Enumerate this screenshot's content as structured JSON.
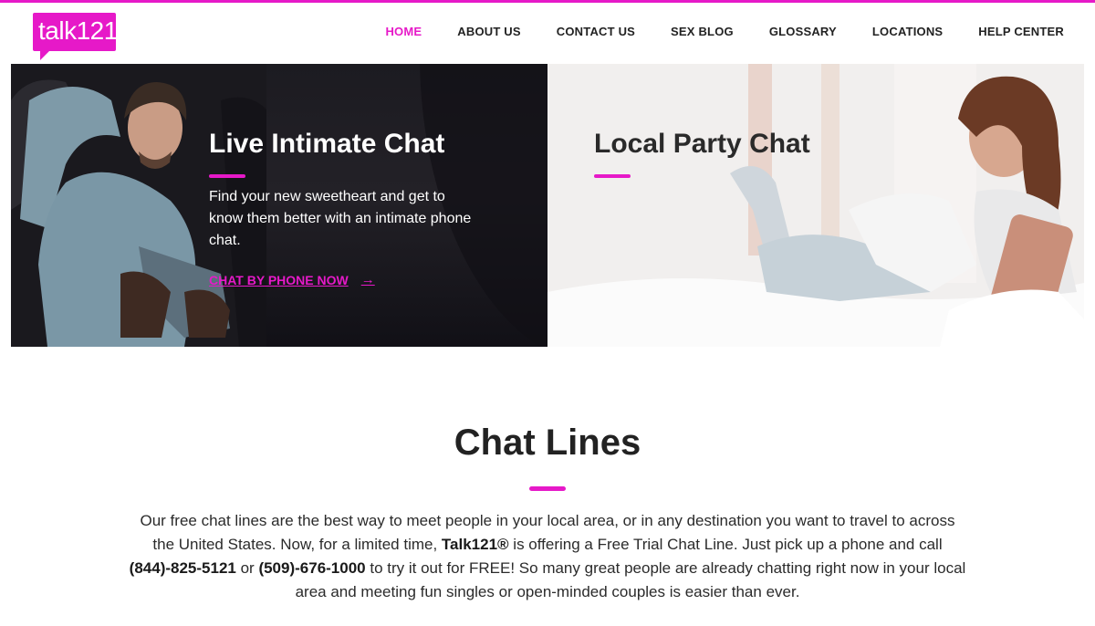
{
  "brand": {
    "logo_text": "talk121",
    "accent_color": "#e619c8"
  },
  "nav": {
    "items": [
      {
        "label": "HOME",
        "active": true
      },
      {
        "label": "ABOUT US",
        "active": false
      },
      {
        "label": "CONTACT US",
        "active": false
      },
      {
        "label": "SEX BLOG",
        "active": false
      },
      {
        "label": "GLOSSARY",
        "active": false
      },
      {
        "label": "LOCATIONS",
        "active": false
      },
      {
        "label": "HELP CENTER",
        "active": false
      }
    ]
  },
  "hero": {
    "left": {
      "title": "Live Intimate Chat",
      "description": "Find your new sweetheart and get to know them better with an intimate phone chat.",
      "cta_label": "CHAT BY PHONE NOW",
      "cta_icon": "arrow-right-icon"
    },
    "right": {
      "title": "Local Party Chat"
    }
  },
  "chat_lines": {
    "title": "Chat Lines",
    "body_part1": "Our free chat lines are the best way to meet people in your local area, or in any destination you want to travel to across the United States. Now, for a limited time, ",
    "brand_name": "Talk121®",
    "body_part2": " is offering a Free Trial Chat Line. Just pick up a phone and call ",
    "phone_1": "(844)-825-5121",
    "body_part3": " or ",
    "phone_2": "(509)-676-1000",
    "body_part4": " to try it out for FREE! So many great people are already chatting right now in your local area and meeting fun singles or open-minded couples is easier than ever."
  }
}
